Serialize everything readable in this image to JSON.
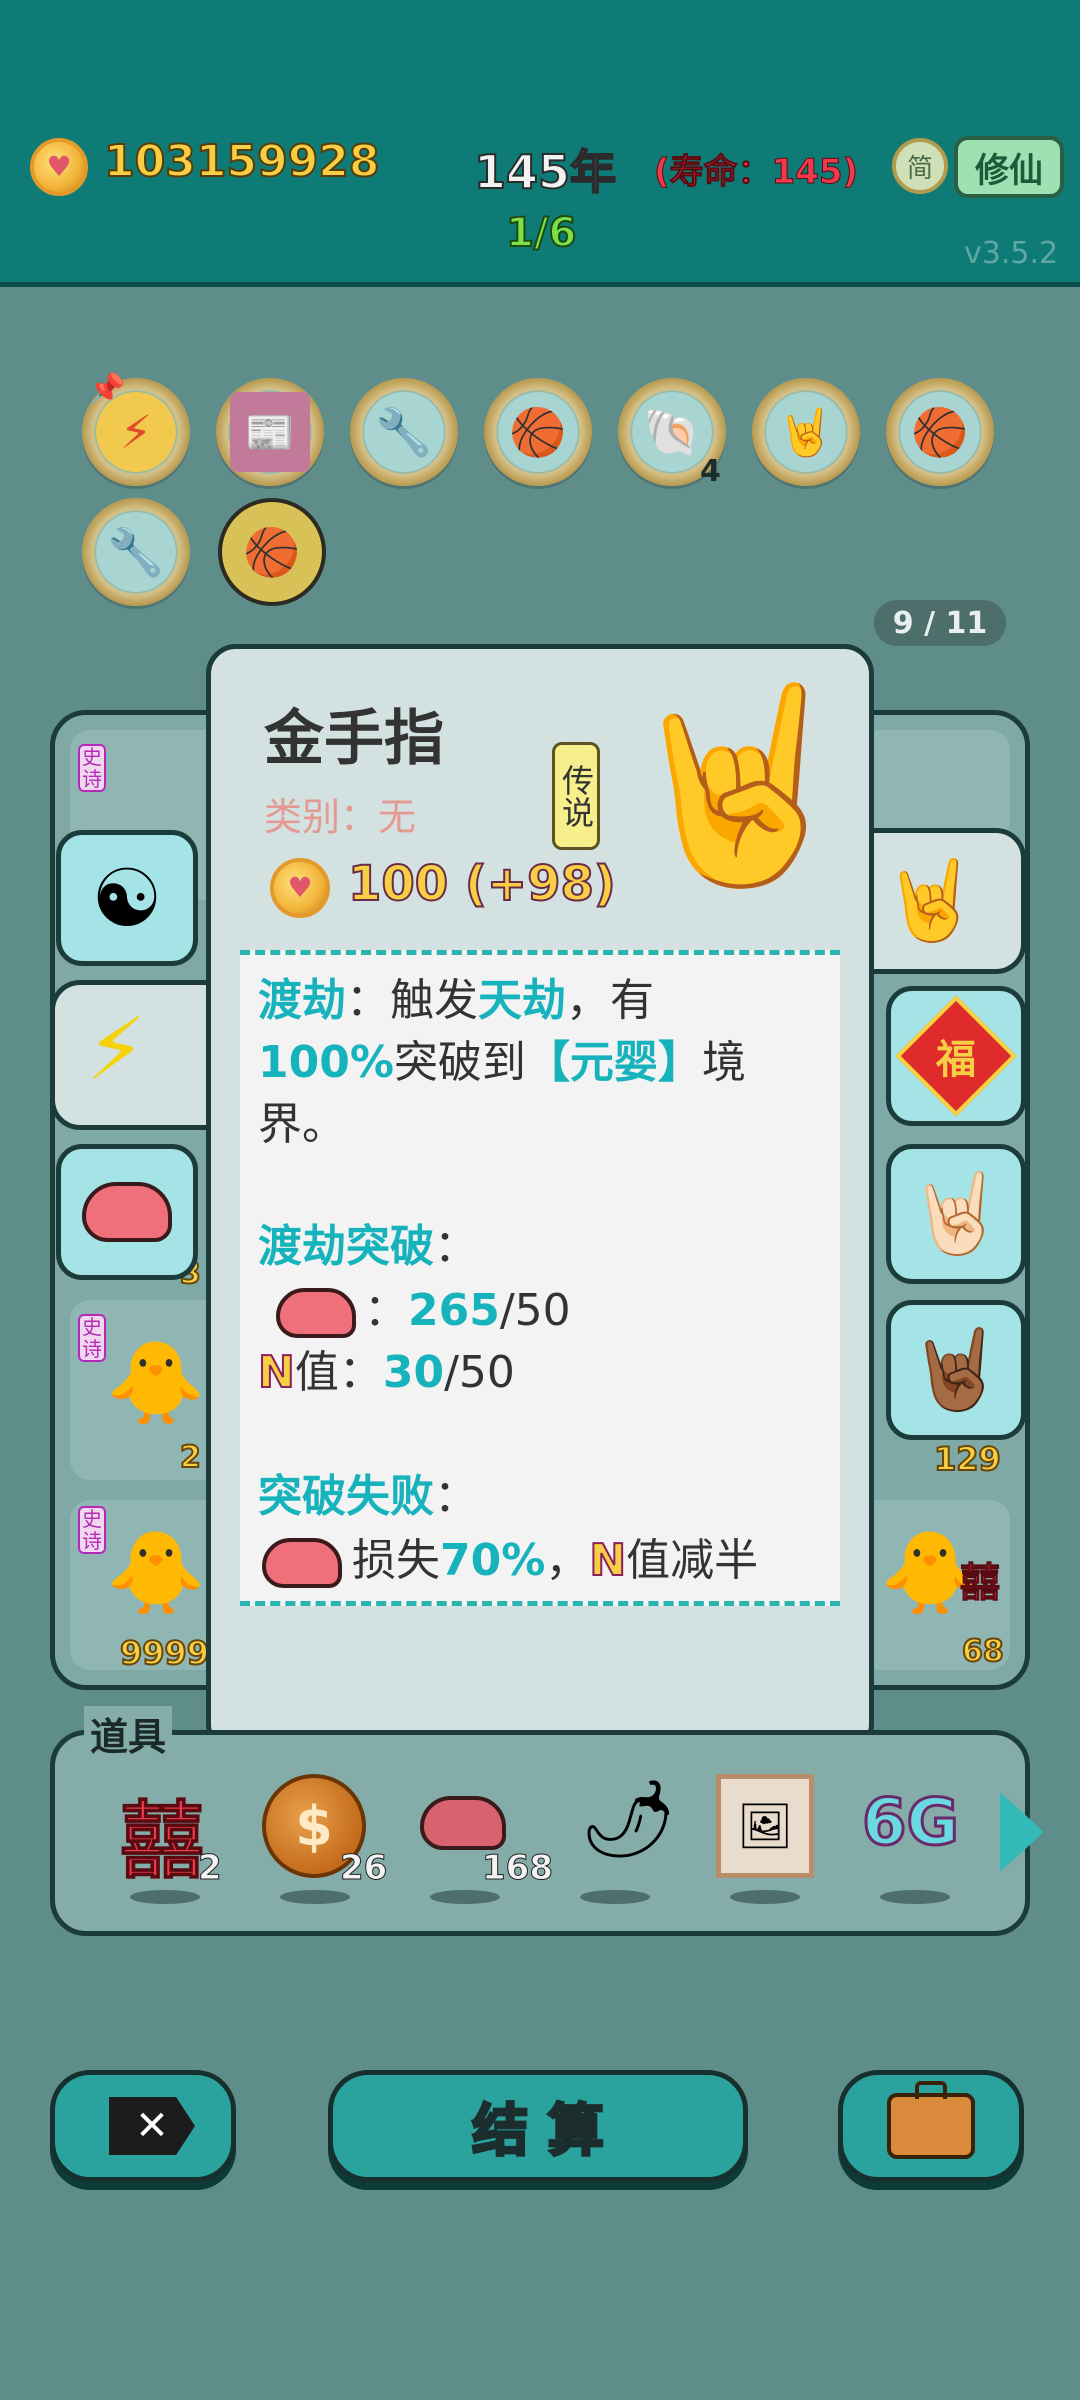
{
  "header": {
    "coins": "103159928",
    "year": "145年",
    "lifespan": "(寿命：145)",
    "stage": "1/6",
    "version": "v3.5.2",
    "simplified_label": "简",
    "cultivate_button": "修仙"
  },
  "relic_page": "9 / 11",
  "relics": [
    {
      "icon": "lightning-icon",
      "count": ""
    },
    {
      "icon": "time-magazine-icon",
      "count": ""
    },
    {
      "icon": "air-pump-icon",
      "count": ""
    },
    {
      "icon": "basketballs-icon",
      "count": ""
    },
    {
      "icon": "shell-icon",
      "count": "4"
    },
    {
      "icon": "rock-hand-icon",
      "count": ""
    },
    {
      "icon": "basketballs-icon",
      "count": ""
    },
    {
      "icon": "air-pump-icon",
      "count": ""
    },
    {
      "icon": "basketballs-icon",
      "count": ""
    }
  ],
  "popup": {
    "title": "金手指",
    "category": "类别：无",
    "rarity": "传说",
    "price": "100 (+98)",
    "desc": {
      "term1": "渡劫",
      "t1": "：触发",
      "term2": "天劫",
      "t2": "，有",
      "pct": "100%",
      "t3": "突破到",
      "realm": "【元婴】",
      "t4": "境",
      "t5": "界。",
      "section1": "渡劫突破",
      "colon": "：",
      "liver_have": "265",
      "liver_need": "/50",
      "n_label": "N",
      "n_text": "值：",
      "n_have": "30",
      "n_need": "/50",
      "section2": "突破失败",
      "loss_text": "损失",
      "loss_pct": "70%",
      "comma": "，",
      "n_half": "值减半"
    }
  },
  "board": {
    "tag": "史诗",
    "left_counts": [
      "3",
      "2",
      "9999"
    ],
    "right_counts": [
      "129",
      "68"
    ]
  },
  "items": {
    "label": "道具",
    "list": [
      {
        "icon": "double-happiness-icon",
        "count": "2"
      },
      {
        "icon": "dollar-coin-icon",
        "count": "26"
      },
      {
        "icon": "liver-icon",
        "count": "168"
      },
      {
        "icon": "chili-pepper-icon",
        "count": ""
      },
      {
        "icon": "framed-picture-icon",
        "count": ""
      },
      {
        "icon": "6g-icon",
        "count": ""
      }
    ],
    "six_g": "6G",
    "happiness": "囍"
  },
  "bottom": {
    "settle_label": "结 算"
  },
  "colors": {
    "teal_bg": "#0e7b76",
    "dim_bg": "#5f8d89",
    "accent_teal": "#17b3bd",
    "gold": "#f6cf45"
  }
}
